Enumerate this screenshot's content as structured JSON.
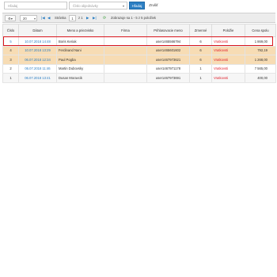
{
  "search": {
    "search_placeholder": "Hľadaj",
    "order_placeholder": "Číslo objednávky",
    "search_button": "Hľadaj",
    "cancel_button": "Zrušiť"
  },
  "toolbar": {
    "gear_label": "⚙▾",
    "page_size": "20",
    "page_label": "Stránka",
    "page_value": "1",
    "page_of": "z 1",
    "record_info": "Zobrazuje sa 1 - 5 z 5 položiek"
  },
  "table": {
    "columns": [
      "Číslo",
      "Dátum",
      "Meno a priezvisko",
      "Firma",
      "Prihlasovacie meno",
      "Zrnenné",
      "Položie",
      "Cena spolu"
    ],
    "rows": [
      {
        "num": "5",
        "date": "10.07.2018 14:48",
        "name": "Boris Keriak",
        "company": "",
        "login": "user1465566794",
        "qty": "6",
        "status": "Vratkovsti",
        "total": "1 869,00"
      },
      {
        "num": "4",
        "date": "10.07.2018 13:29",
        "name": "Ferdinand Nani",
        "company": "",
        "login": "user1465601602",
        "qty": "6",
        "status": "Vratkovsti",
        "total": "792,19"
      },
      {
        "num": "3",
        "date": "06.07.2018 12:34",
        "name": "Paul Pogba",
        "company": "",
        "login": "user1467973621",
        "qty": "6",
        "status": "Vratkovsti",
        "total": "1 268,00"
      },
      {
        "num": "2",
        "date": "06.07.2018 11:46",
        "name": "Martin Dubovsky",
        "company": "",
        "login": "user1467971178",
        "qty": "1",
        "status": "Vratkovsti",
        "total": "7 565,00"
      },
      {
        "num": "1",
        "date": "06.07.2018 13:41",
        "name": "Dusan Moravcik",
        "company": "",
        "login": "user1467973691",
        "qty": "1",
        "status": "Vratkovsti",
        "total": "400,00"
      }
    ]
  },
  "colors": {
    "accent": "#2d7fc3",
    "highlight_row": "#f7dcb4",
    "status": "#e0242f",
    "selection_outline": "#d9161c"
  }
}
